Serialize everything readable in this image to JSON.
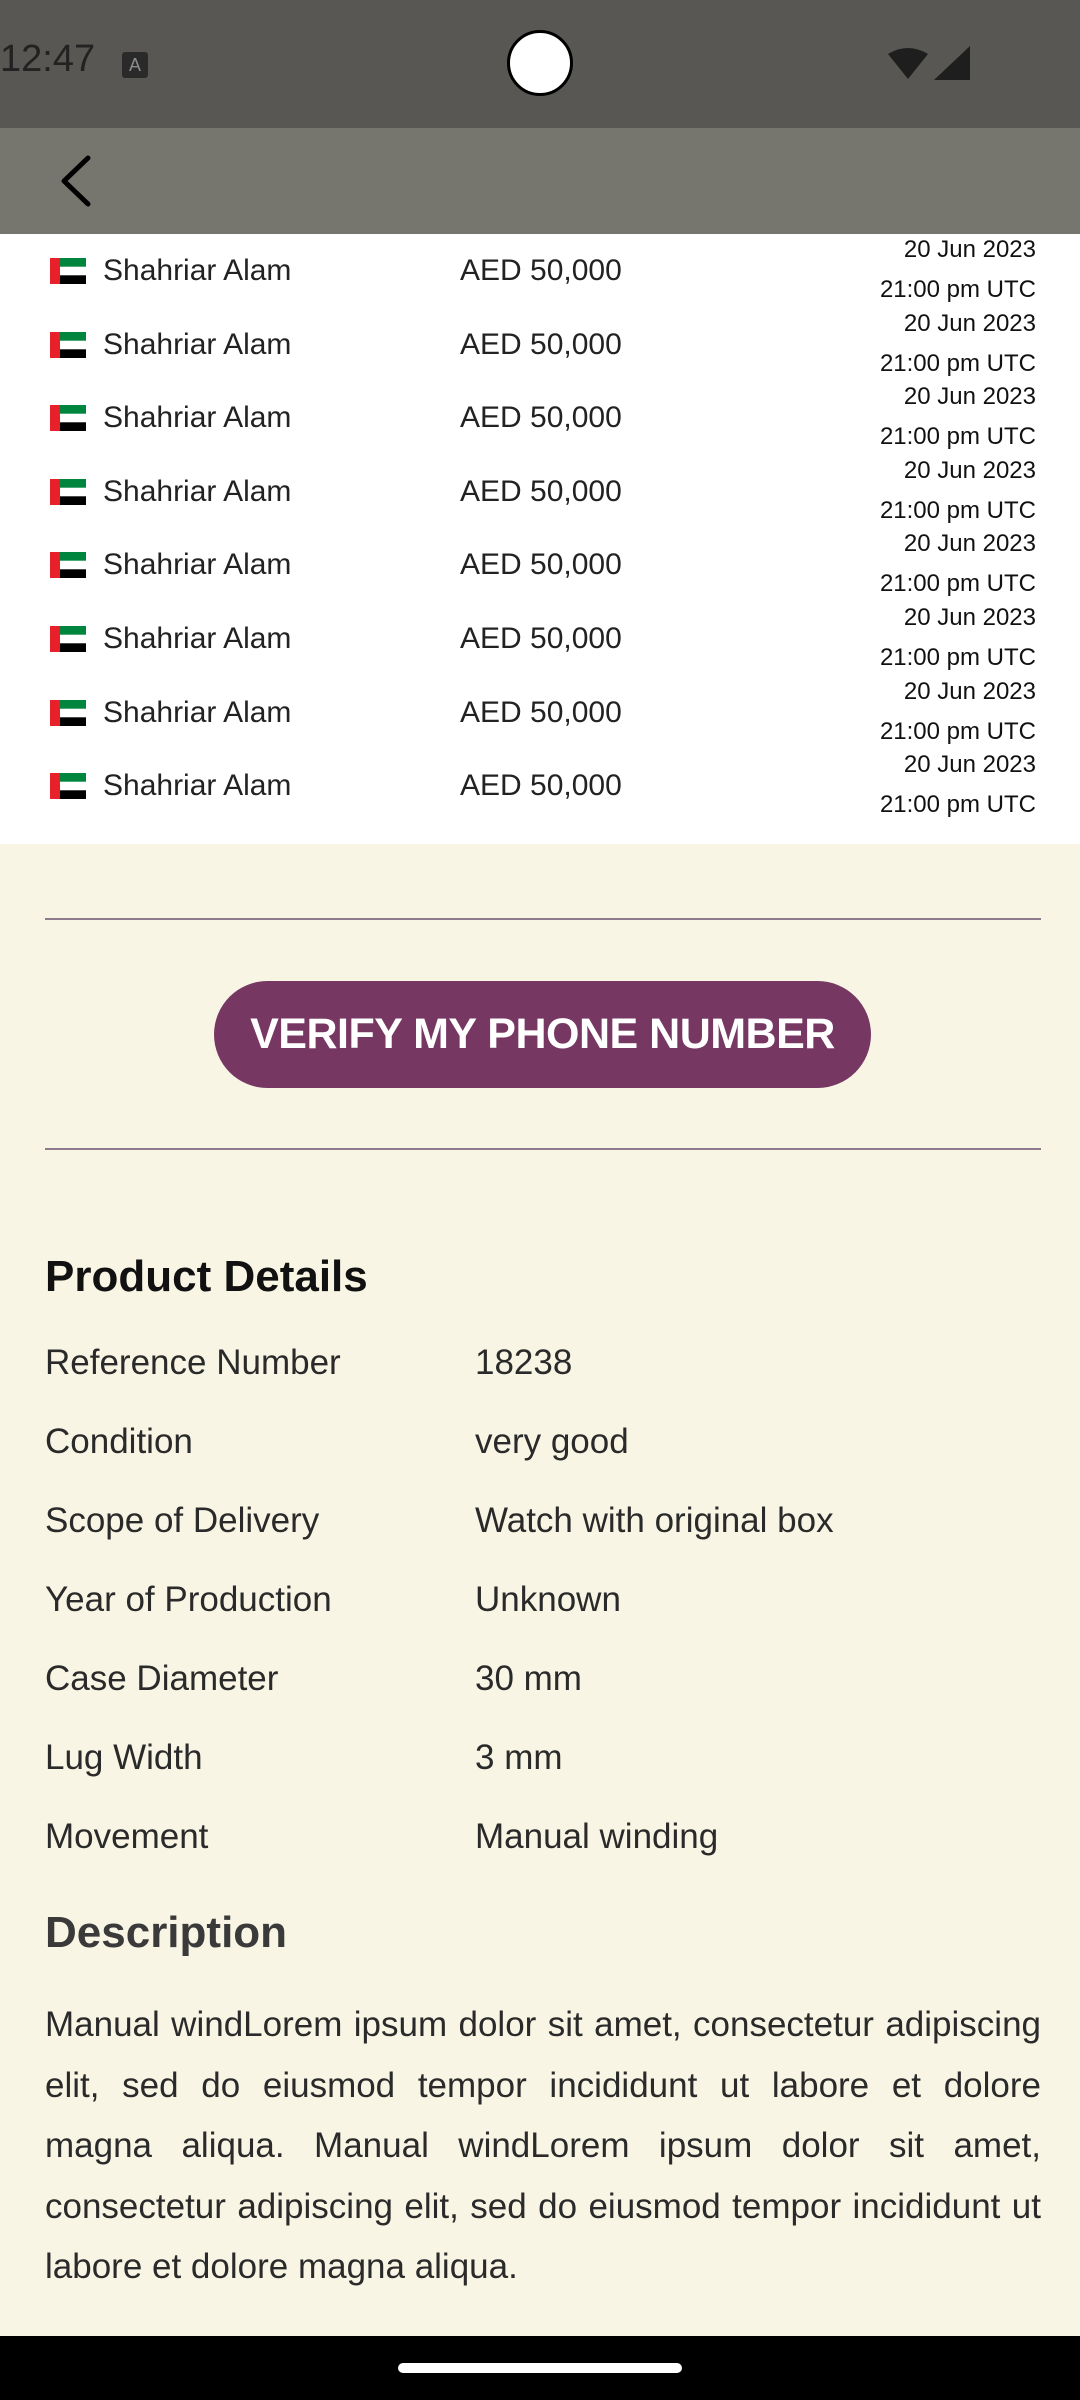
{
  "status_bar": {
    "time": "12:47",
    "notification_icon_letter": "A",
    "icons": [
      "wifi-icon",
      "signal-icon"
    ]
  },
  "app_bar": {
    "back_icon": "chevron-left-icon"
  },
  "bids": [
    {
      "flag": "uae-flag-icon",
      "name": "Shahriar Alam",
      "amount": "AED 50,000",
      "date": "20 Jun 2023",
      "time": "21:00 pm UTC"
    },
    {
      "flag": "uae-flag-icon",
      "name": "Shahriar Alam",
      "amount": "AED 50,000",
      "date": "20 Jun 2023",
      "time": "21:00 pm UTC"
    },
    {
      "flag": "uae-flag-icon",
      "name": "Shahriar Alam",
      "amount": "AED 50,000",
      "date": "20 Jun 2023",
      "time": "21:00 pm UTC"
    },
    {
      "flag": "uae-flag-icon",
      "name": "Shahriar Alam",
      "amount": "AED 50,000",
      "date": "20 Jun 2023",
      "time": "21:00 pm UTC"
    },
    {
      "flag": "uae-flag-icon",
      "name": "Shahriar Alam",
      "amount": "AED 50,000",
      "date": "20 Jun 2023",
      "time": "21:00 pm UTC"
    },
    {
      "flag": "uae-flag-icon",
      "name": "Shahriar Alam",
      "amount": "AED 50,000",
      "date": "20 Jun 2023",
      "time": "21:00 pm UTC"
    },
    {
      "flag": "uae-flag-icon",
      "name": "Shahriar Alam",
      "amount": "AED 50,000",
      "date": "20 Jun 2023",
      "time": "21:00 pm UTC"
    },
    {
      "flag": "uae-flag-icon",
      "name": "Shahriar Alam",
      "amount": "AED 50,000",
      "date": "20 Jun 2023",
      "time": "21:00 pm UTC"
    }
  ],
  "verify_button": {
    "label": "VERIFY MY PHONE NUMBER"
  },
  "product_details": {
    "title": "Product Details",
    "rows": [
      {
        "label": "Reference Number",
        "value": "18238"
      },
      {
        "label": "Condition",
        "value": "very good"
      },
      {
        "label": "Scope of Delivery",
        "value": "Watch with original box"
      },
      {
        "label": "Year of Production",
        "value": "Unknown"
      },
      {
        "label": "Case Diameter",
        "value": "30 mm"
      },
      {
        "label": "Lug Width",
        "value": "3 mm"
      },
      {
        "label": "Movement",
        "value": "Manual winding"
      }
    ]
  },
  "description": {
    "title": "Description",
    "text": "Manual windLorem ipsum dolor sit amet, consectetur adipiscing elit, sed do eiusmod tempor incididunt ut labore et dolore magna aliqua. Manual windLorem ipsum dolor sit amet, consectetur adipiscing elit, sed do eiusmod tempor incididunt ut labore et dolore magna aliqua."
  },
  "colors": {
    "accent": "#763763",
    "page_background": "#f8f5e4",
    "app_bar": "#76756e",
    "status_bar": "#585753",
    "flag_red": "#e8202a",
    "flag_green": "#00853f"
  }
}
